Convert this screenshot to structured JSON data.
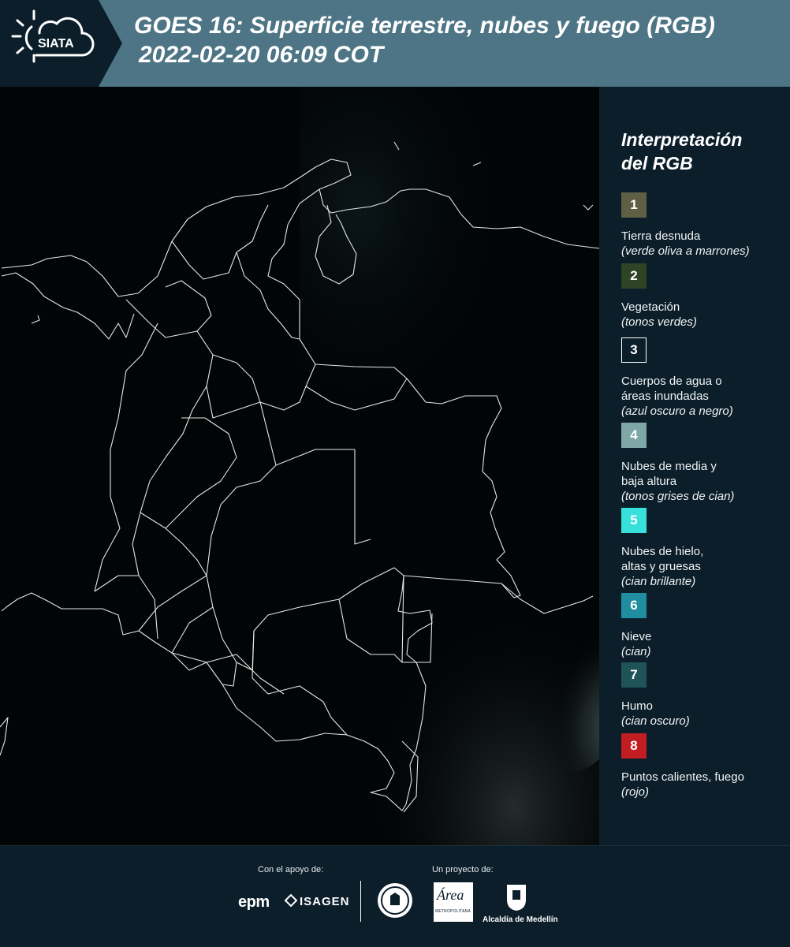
{
  "header": {
    "logo_text": "SIATA",
    "title_line1": "GOES 16: Superficie terrestre, nubes y fuego (RGB)",
    "title_line2": "2022-02-20 06:09 COT"
  },
  "legend": {
    "title_line1": "Interpretación",
    "title_line2": "del RGB",
    "items": [
      {
        "num": "1",
        "color": "#5f5f45",
        "label": [
          "Tierra desnuda"
        ],
        "sub": "(verde oliva a marrones)"
      },
      {
        "num": "2",
        "color": "#2f4425",
        "label": [
          "Vegetación"
        ],
        "sub": "(tonos verdes)"
      },
      {
        "num": "3",
        "color": "#0b1e2a",
        "label": [
          "Cuerpos de agua o",
          "áreas inundadas"
        ],
        "sub": "(azul oscuro a negro)"
      },
      {
        "num": "4",
        "color": "#7fa7a8",
        "label": [
          "Nubes de media y",
          "baja altura"
        ],
        "sub": "(tonos grises de cian)"
      },
      {
        "num": "5",
        "color": "#38e0dc",
        "label": [
          "Nubes de hielo,",
          "altas y gruesas"
        ],
        "sub": "(cian brillante)"
      },
      {
        "num": "6",
        "color": "#1e8ea0",
        "label": [
          "Nieve"
        ],
        "sub": "(cian)"
      },
      {
        "num": "7",
        "color": "#1e5357",
        "label": [
          "Humo"
        ],
        "sub": "(cian oscuro)"
      },
      {
        "num": "8",
        "color": "#c21d22",
        "label": [
          "Puntos calientes, fuego"
        ],
        "sub": "(rojo)"
      }
    ]
  },
  "footer": {
    "support_caption": "Con el apoyo de:",
    "project_caption": "Un proyecto de:",
    "epm": "epm",
    "isagen": "ISAGEN",
    "area_title": "Área",
    "area_sub": "METROPOLITANA",
    "alcaldia": "Alcaldía de Medellín"
  }
}
